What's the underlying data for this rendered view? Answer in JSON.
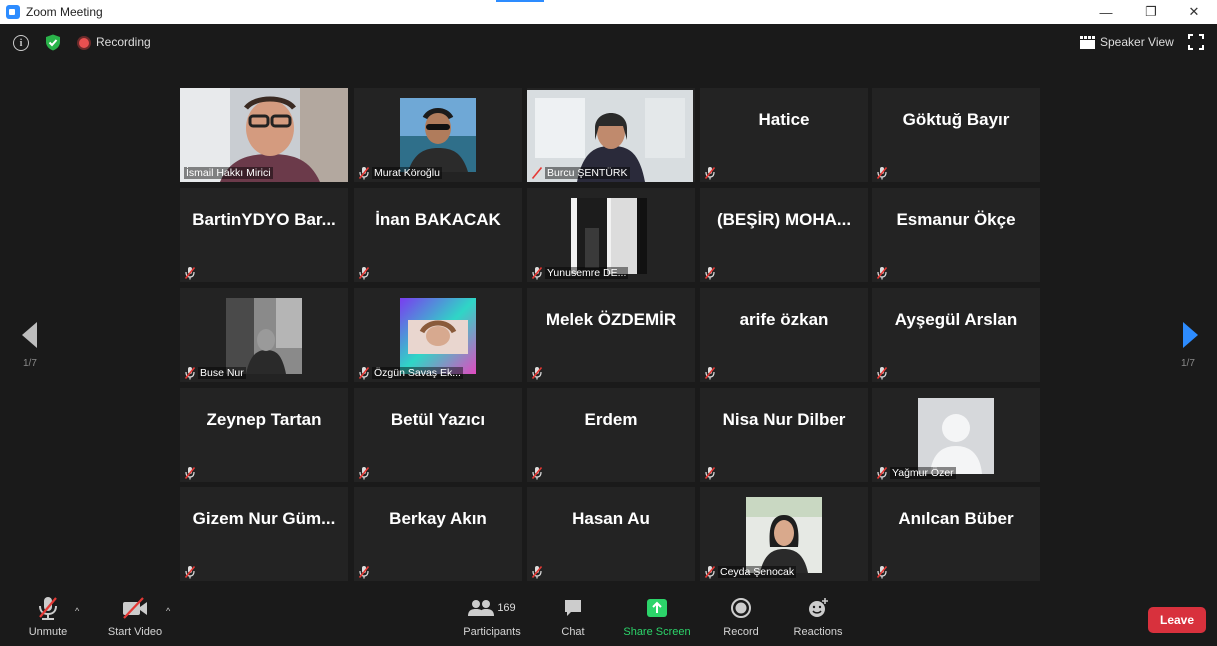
{
  "window": {
    "title": "Zoom Meeting",
    "controls": {
      "minimize": "—",
      "restore": "❐",
      "close": "✕"
    }
  },
  "topbar": {
    "recording_label": "Recording",
    "speaker_view_label": "Speaker View"
  },
  "colors": {
    "accent": "#2d8cff",
    "active_speaker": "#c8d63c",
    "recording": "#e95050",
    "leave": "#d8313d",
    "share_green": "#2cd46a",
    "tile_bg": "#232323"
  },
  "pagination": {
    "left": "1/7",
    "right": "1/7"
  },
  "participants": [
    {
      "name": "İsmail Hakkı Mirici",
      "display": "",
      "video": true,
      "muted": false,
      "active": true
    },
    {
      "name": "Murat Köroğlu",
      "display": "",
      "video": true,
      "muted": true
    },
    {
      "name": "Burcu ŞENTÜRK",
      "display": "",
      "video": true,
      "muted": true
    },
    {
      "name": "",
      "display": "Hatice",
      "video": false,
      "muted": true
    },
    {
      "name": "",
      "display": "Göktuğ Bayır",
      "video": false,
      "muted": true
    },
    {
      "name": "",
      "display": "BartinYDYO Bar...",
      "video": false,
      "muted": true
    },
    {
      "name": "",
      "display": "İnan BAKACAK",
      "video": false,
      "muted": true
    },
    {
      "name": "Yunusemre DE...",
      "display": "",
      "video": true,
      "muted": true
    },
    {
      "name": "",
      "display": "(BEŞİR) MOHA...",
      "video": false,
      "muted": true
    },
    {
      "name": "",
      "display": "Esmanur Ökçe",
      "video": false,
      "muted": true
    },
    {
      "name": "Buse Nur",
      "display": "",
      "video": true,
      "muted": true
    },
    {
      "name": "Özgün Savaş Ek...",
      "display": "",
      "video": true,
      "muted": true
    },
    {
      "name": "",
      "display": "Melek ÖZDEMİR",
      "video": false,
      "muted": true
    },
    {
      "name": "",
      "display": "arife özkan",
      "video": false,
      "muted": true
    },
    {
      "name": "",
      "display": "Ayşegül Arslan",
      "video": false,
      "muted": true
    },
    {
      "name": "",
      "display": "Zeynep Tartan",
      "video": false,
      "muted": true
    },
    {
      "name": "",
      "display": "Betül Yazıcı",
      "video": false,
      "muted": true
    },
    {
      "name": "",
      "display": "Erdem",
      "video": false,
      "muted": true
    },
    {
      "name": "",
      "display": "Nisa Nur Dilber",
      "video": false,
      "muted": true
    },
    {
      "name": "Yağmur Özer",
      "display": "",
      "video": true,
      "muted": true
    },
    {
      "name": "",
      "display": "Gizem Nur Güm...",
      "video": false,
      "muted": true
    },
    {
      "name": "",
      "display": "Berkay Akın",
      "video": false,
      "muted": true
    },
    {
      "name": "",
      "display": "Hasan Au",
      "video": false,
      "muted": true
    },
    {
      "name": "Ceyda Şenocak",
      "display": "",
      "video": true,
      "muted": true
    },
    {
      "name": "",
      "display": "Anılcan Büber",
      "video": false,
      "muted": true
    }
  ],
  "toolbar": {
    "unmute": "Unmute",
    "start_video": "Start Video",
    "participants": "Participants",
    "participant_count": "169",
    "chat": "Chat",
    "share_screen": "Share Screen",
    "record": "Record",
    "reactions": "Reactions",
    "leave": "Leave"
  }
}
